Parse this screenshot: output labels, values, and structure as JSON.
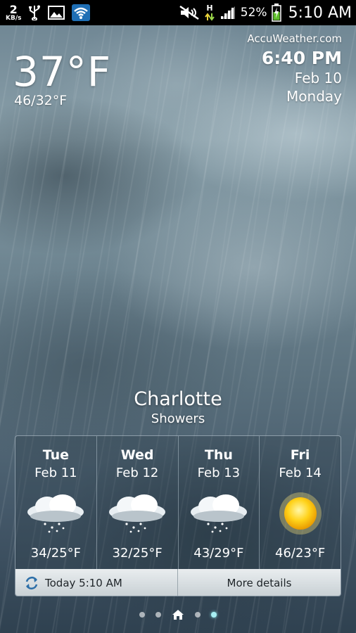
{
  "status_bar": {
    "speed_value": "2",
    "speed_unit": "KB/s",
    "network_label": "H",
    "battery_percent": "52%",
    "time": "5:10 AM",
    "icons": [
      "usb-icon",
      "image-icon",
      "wifi-icon",
      "mute-icon",
      "data-arrows-icon",
      "signal-icon",
      "battery-charging-icon"
    ]
  },
  "weather": {
    "current_temp": "37°F",
    "hi_lo": "46/32°F",
    "source": "AccuWeather.com",
    "local_time": "6:40 PM",
    "date": "Feb 10",
    "weekday": "Monday",
    "city": "Charlotte",
    "condition": "Showers"
  },
  "forecast": [
    {
      "day": "Tue",
      "date": "Feb 11",
      "icon": "snow-cloud-icon",
      "temps": "34/25°F"
    },
    {
      "day": "Wed",
      "date": "Feb 12",
      "icon": "snow-cloud-icon",
      "temps": "32/25°F"
    },
    {
      "day": "Thu",
      "date": "Feb 13",
      "icon": "snow-cloud-icon",
      "temps": "43/29°F"
    },
    {
      "day": "Fri",
      "date": "Feb 14",
      "icon": "sun-icon",
      "temps": "46/23°F"
    }
  ],
  "footer": {
    "updated": "Today 5:10 AM",
    "more": "More details"
  },
  "pager": {
    "pages": 5,
    "active_index": 4,
    "home_index": 2
  },
  "colors": {
    "accent_dot": "#a8f0f4",
    "footer_bg": "#e0e5e8"
  }
}
